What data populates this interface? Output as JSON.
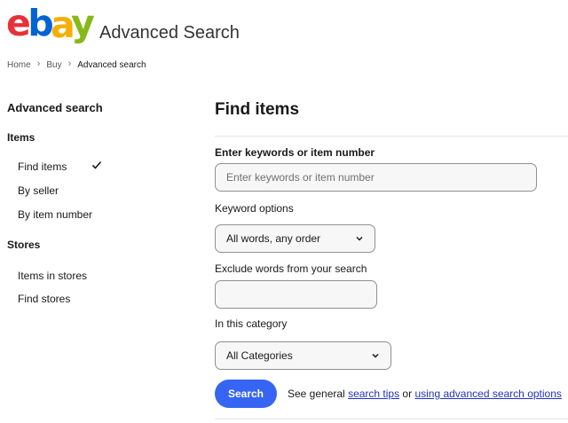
{
  "header": {
    "logo_text": "ebay",
    "title": "Advanced Search"
  },
  "breadcrumb": [
    "Home",
    "Buy",
    "Advanced search"
  ],
  "sidebar": {
    "heading": "Advanced search",
    "items_section": "Items",
    "items": [
      {
        "label": "Find items",
        "selected": true
      },
      {
        "label": "By seller"
      },
      {
        "label": "By item number"
      }
    ],
    "stores_section": "Stores",
    "stores": [
      {
        "label": "Items in stores"
      },
      {
        "label": "Find stores"
      }
    ]
  },
  "main": {
    "title": "Find items",
    "keywords": {
      "label": "Enter keywords or item number",
      "placeholder": "Enter keywords or item number",
      "value": ""
    },
    "keyword_options": {
      "label": "Keyword options",
      "selected": "All words, any order"
    },
    "exclude": {
      "label": "Exclude words from your search",
      "value": ""
    },
    "category": {
      "label": "In this category",
      "selected": "All Categories"
    },
    "search_button": "Search",
    "tips": {
      "prefix": "See general ",
      "link1": "search tips",
      "middle": " or ",
      "link2": "using advanced search options"
    }
  },
  "colors": {
    "logo_e": "#e53238",
    "logo_b": "#0064d2",
    "logo_a": "#f5af02",
    "logo_y": "#86b817",
    "primary_button": "#3665f3",
    "link": "#2233bb"
  }
}
